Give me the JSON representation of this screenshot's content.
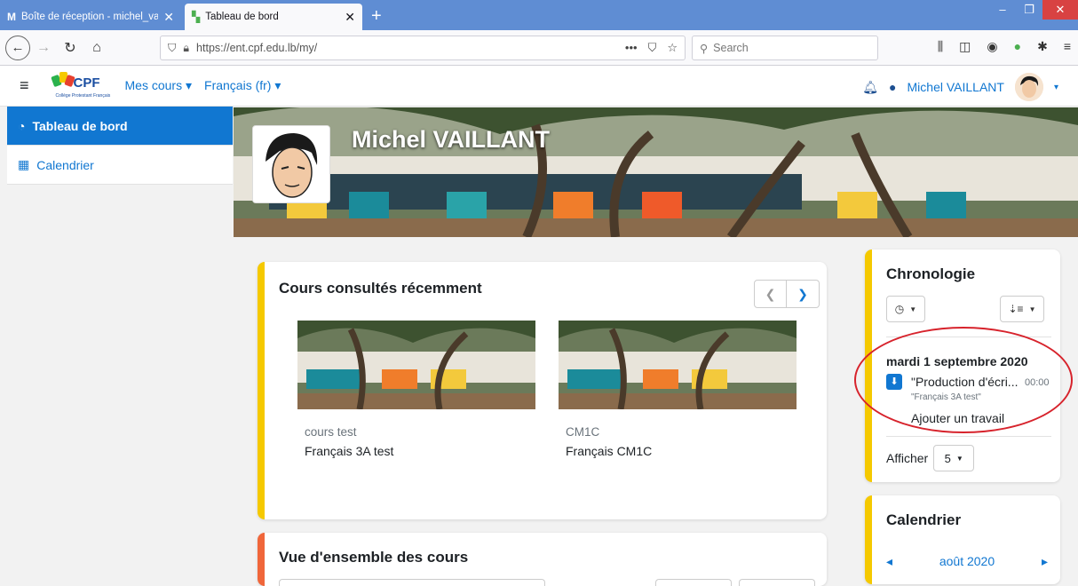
{
  "browser": {
    "tabs": [
      {
        "title": "Boîte de réception - michel_vai"
      },
      {
        "title": "Tableau de bord"
      }
    ],
    "url": "https://ent.cpf.edu.lb/my/",
    "search_placeholder": "Search"
  },
  "header": {
    "logo_text": "CPF",
    "logo_sub": "Collège Protestant Français",
    "menu": [
      "Mes cours",
      "Français (fr)"
    ],
    "user_name": "Michel VAILLANT"
  },
  "drawer": {
    "items": [
      "Tableau de bord",
      "Calendrier"
    ]
  },
  "profile": {
    "name": "Michel VAILLANT"
  },
  "recent": {
    "title": "Cours consultés récemment",
    "courses": [
      {
        "category": "cours test",
        "name": "Français 3A test"
      },
      {
        "category": "CM1C",
        "name": "Français CM1C"
      }
    ]
  },
  "overview": {
    "title": "Vue d'ensemble des cours"
  },
  "timeline": {
    "title": "Chronologie",
    "date": "mardi 1 septembre 2020",
    "event_title": "\"Production d'écri...",
    "event_time": "00:00",
    "event_course": "\"Français 3A test\"",
    "event_action": "Ajouter un travail",
    "show_label": "Afficher",
    "show_value": "5"
  },
  "calendar": {
    "title": "Calendrier",
    "month": "août 2020"
  },
  "colors": {
    "accent": "#1177d1",
    "card_border": "#f5c900",
    "overview_border": "#f0663a",
    "annotation": "#d7232c"
  }
}
